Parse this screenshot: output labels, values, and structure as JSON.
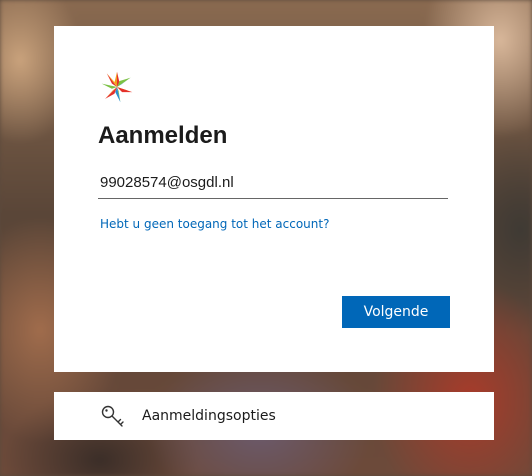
{
  "signin": {
    "title": "Aanmelden",
    "email_value": "99028574@osgdl.nl",
    "no_access_link": "Hebt u geen toegang tot het account?",
    "next_button": "Volgende"
  },
  "options": {
    "label": "Aanmeldingsopties",
    "icon": "key-icon"
  },
  "colors": {
    "accent": "#0067b8",
    "card": "#ffffff",
    "text": "#1b1b1b"
  },
  "logo": {
    "icon": "star-logo-icon"
  }
}
